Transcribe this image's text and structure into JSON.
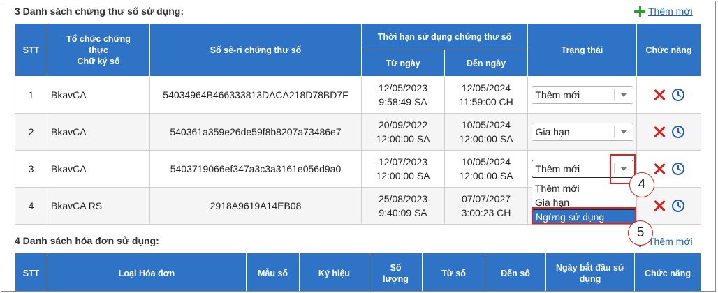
{
  "section3": {
    "title": "3 Danh sách chứng thư số sử dụng:",
    "add_label": "Thêm mới",
    "headers": {
      "stt": "STT",
      "org_line1": "Tổ chức chứng",
      "org_line2": "thực",
      "org_line3": "Chữ ký số",
      "serial": "Số sê-ri chứng thư số",
      "validity": "Thời hạn sử dụng chứng thư số",
      "from": "Từ ngày",
      "to": "Đến ngày",
      "status": "Trạng thái",
      "function": "Chức năng"
    },
    "rows": [
      {
        "stt": "1",
        "org": "BkavCA",
        "serial": "54034964B466333813DACA218D78BD7F",
        "from_date": "12/05/2023",
        "from_time": "9:58:49 SA",
        "to_date": "12/05/2024",
        "to_time": "11:59:00 CH",
        "status": "Thêm mới"
      },
      {
        "stt": "2",
        "org": "BkavCA",
        "serial": "540361a359e26de59f8b8207a73486e7",
        "from_date": "20/09/2022",
        "from_time": "12:00:00 SA",
        "to_date": "10/05/2024",
        "to_time": "12:00:00 SA",
        "status": "Gia hạn"
      },
      {
        "stt": "3",
        "org": "BkavCA",
        "serial": "5403719066ef347a3c3a3161e056d9a0",
        "from_date": "12/07/2023",
        "from_time": "12:00:00 SA",
        "to_date": "10/05/2024",
        "to_time": "12:00:00 SA",
        "status": "Thêm mới"
      },
      {
        "stt": "4",
        "org": "BkavCA RS",
        "serial": "2918A9619A14EB08",
        "from_date": "25/08/2023",
        "from_time": "9:40:09 SA",
        "to_date": "07/07/2027",
        "to_time": "3:00:23 CH",
        "status": ""
      }
    ],
    "dropdown_options": [
      "Thêm mới",
      "Gia hạn",
      "Ngừng sử dụng"
    ],
    "highlighted_option": "Ngừng sử dụng"
  },
  "callouts": {
    "step4": "4",
    "step5": "5"
  },
  "section4": {
    "title": "4 Danh sách hóa đơn sử dụng:",
    "add_label": "Thêm mới",
    "headers": {
      "stt": "STT",
      "type": "Loại Hóa đơn",
      "form": "Mẫu số",
      "symbol": "Ký hiệu",
      "qty_line1": "Số",
      "qty_line2": "lượng",
      "from_no": "Từ số",
      "to_no": "Đến số",
      "start_line1": "Ngày bắt đầu sử",
      "start_line2": "dụng",
      "function": "Chức năng"
    }
  },
  "colors": {
    "header_bg": "#2f73c6",
    "delete": "#e01c1c",
    "history": "#1d5fb3",
    "add": "#2aa12e",
    "annotation": "#e02020"
  },
  "icons": {
    "add": "plus-icon",
    "delete": "close-icon",
    "history": "clock-icon",
    "dropdown": "chevron-down-icon"
  }
}
